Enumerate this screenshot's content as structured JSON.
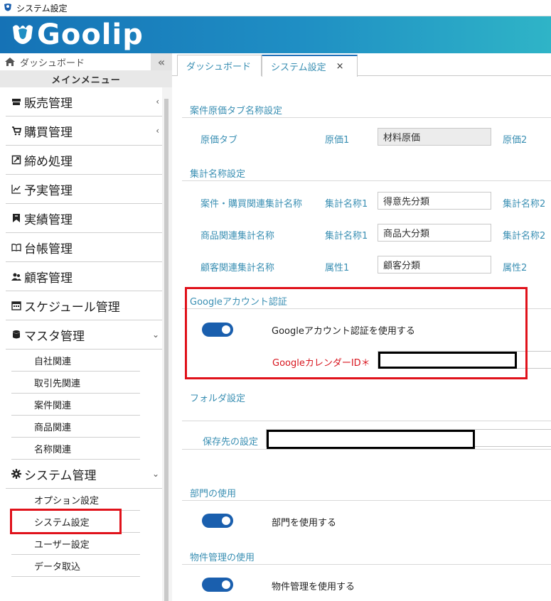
{
  "window": {
    "title": "システム設定"
  },
  "brand": {
    "logo_text": "Goolip",
    "gradient_start": "#1572b6",
    "gradient_end": "#2fb4c7"
  },
  "sidebar": {
    "dashboard_label": "ダッシュボード",
    "collapse_glyph": "«",
    "main_menu_label": "メインメニュー",
    "menu": [
      {
        "label": "販売管理",
        "icon": "store-icon",
        "chevron": "‹"
      },
      {
        "label": "購買管理",
        "icon": "cart-icon",
        "chevron": "‹"
      },
      {
        "label": "締め処理",
        "icon": "closing-icon",
        "chevron": ""
      },
      {
        "label": "予実管理",
        "icon": "chart-icon",
        "chevron": ""
      },
      {
        "label": "実績管理",
        "icon": "bookmark-icon",
        "chevron": ""
      },
      {
        "label": "台帳管理",
        "icon": "book-icon",
        "chevron": ""
      },
      {
        "label": "顧客管理",
        "icon": "users-icon",
        "chevron": ""
      },
      {
        "label": "スケジュール管理",
        "icon": "calendar-icon",
        "chevron": ""
      },
      {
        "label": "マスタ管理",
        "icon": "database-icon",
        "chevron": "⌄"
      }
    ],
    "master_sub": [
      "自社関連",
      "取引先関連",
      "案件関連",
      "商品関連",
      "名称関連"
    ],
    "system_menu": {
      "label": "システム管理",
      "icon": "gear-icon",
      "chevron": "⌄"
    },
    "system_sub": [
      "オプション設定",
      "システム設定",
      "ユーザー設定",
      "データ取込"
    ]
  },
  "tabs": [
    {
      "label": "ダッシュボード"
    },
    {
      "label": "システム設定",
      "close": "×"
    }
  ],
  "sections": {
    "cost_tab": {
      "title": "案件原価タブ名称設定",
      "row_label": "原価タブ",
      "field1_label": "原価1",
      "field1_value": "材料原価",
      "field2_label": "原価2"
    },
    "aggregate": {
      "title": "集計名称設定",
      "rows": [
        {
          "label": "案件・購買関連集計名称",
          "f1_label": "集計名称1",
          "f1_value": "得意先分類",
          "f2_label": "集計名称2"
        },
        {
          "label": "商品関連集計名称",
          "f1_label": "集計名称1",
          "f1_value": "商品大分類",
          "f2_label": "集計名称2"
        },
        {
          "label": "顧客関連集計名称",
          "f1_label": "属性1",
          "f1_value": "顧客分類",
          "f2_label": "属性2"
        }
      ]
    },
    "google": {
      "title": "Googleアカウント認証",
      "toggle_label": "Googleアカウント認証を使用する",
      "toggle_on": true,
      "calendar_label": "GoogleカレンダーID＊"
    },
    "folder": {
      "title": "フォルダ設定",
      "save_label": "保存先の設定"
    },
    "department": {
      "title": "部門の使用",
      "toggle_label": "部門を使用する",
      "toggle_on": true
    },
    "property": {
      "title": "物件管理の使用",
      "toggle_label": "物件管理を使用する",
      "toggle_on": true
    }
  },
  "colors": {
    "accent": "#3a8fb3",
    "toggle": "#1a5fae",
    "highlight": "#e0121b"
  }
}
